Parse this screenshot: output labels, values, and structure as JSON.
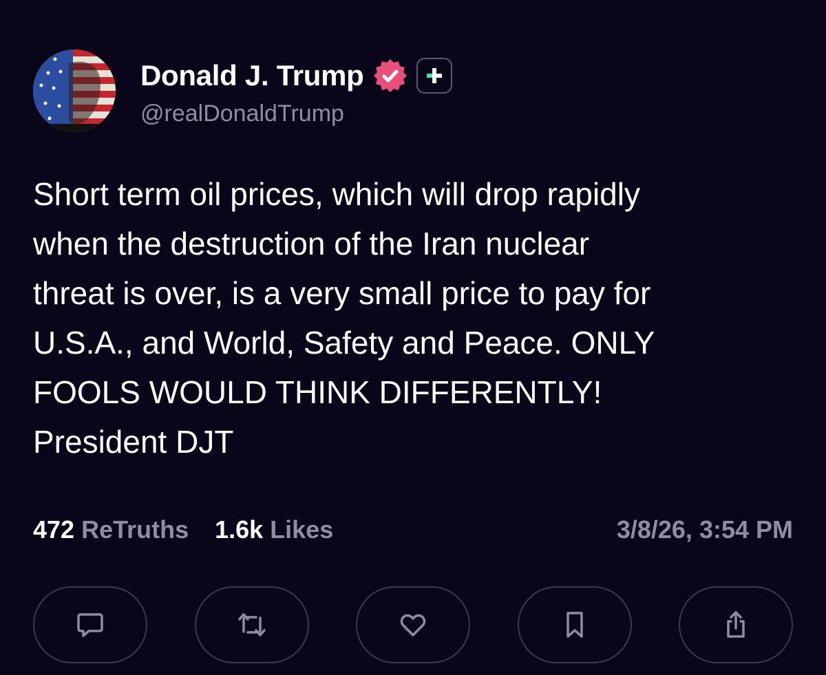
{
  "post": {
    "author": {
      "display_name": "Donald J. Trump",
      "handle": "@realDonaldTrump",
      "verified_icon": "verified-badge-icon",
      "badge_icon": "plus-icon"
    },
    "text": "Short term oil prices, which will drop rapidly\nwhen the destruction of the Iran nuclear\nthreat is over, is a very small price to pay for\nU.S.A., and World, Safety and Peace. ONLY\nFOOLS WOULD THINK DIFFERENTLY!\nPresident DJT",
    "stats": {
      "retruths_count": "472",
      "retruths_label": "ReTruths",
      "likes_count": "1.6k",
      "likes_label": "Likes"
    },
    "timestamp": "3/8/26, 3:54 PM"
  },
  "actions": [
    {
      "icon": "reply-icon"
    },
    {
      "icon": "retruth-icon"
    },
    {
      "icon": "heart-icon"
    },
    {
      "icon": "bookmark-icon"
    },
    {
      "icon": "share-icon"
    }
  ],
  "colors": {
    "background": "#080618",
    "text_primary": "#ffffff",
    "text_secondary": "#8e8ea0",
    "verified_badge": "#e8507a",
    "plus_accent": "#3ee6b0",
    "button_border": "#3a3a4c"
  }
}
